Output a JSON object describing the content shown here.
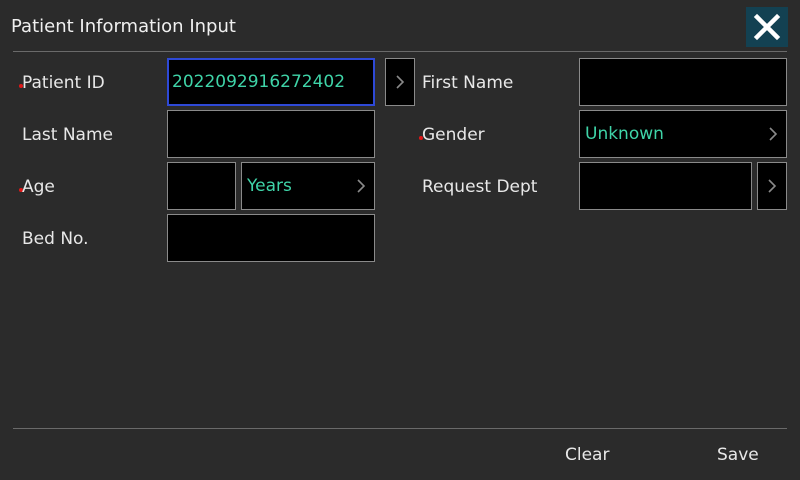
{
  "dialog": {
    "title": "Patient Information Input",
    "close_icon": "close-icon"
  },
  "fields": {
    "patient_id": {
      "label": "Patient ID",
      "value": "202209291627240​2",
      "required": true
    },
    "first_name": {
      "label": "First Name",
      "value": ""
    },
    "last_name": {
      "label": "Last Name",
      "value": ""
    },
    "gender": {
      "label": "Gender",
      "value": "Unknown",
      "required": true
    },
    "age": {
      "label": "Age",
      "value": "",
      "unit": "Years",
      "required": true
    },
    "request_dept": {
      "label": "Request Dept",
      "value": ""
    },
    "bed_no": {
      "label": "Bed No.",
      "value": ""
    }
  },
  "footer": {
    "clear_label": "Clear",
    "save_label": "Save"
  },
  "colors": {
    "background": "#2b2b2b",
    "field_bg": "#000000",
    "value_text": "#3fd4a8",
    "focus_border": "#2e49d6",
    "required_marker": "#e01818",
    "close_bg": "#134152"
  }
}
